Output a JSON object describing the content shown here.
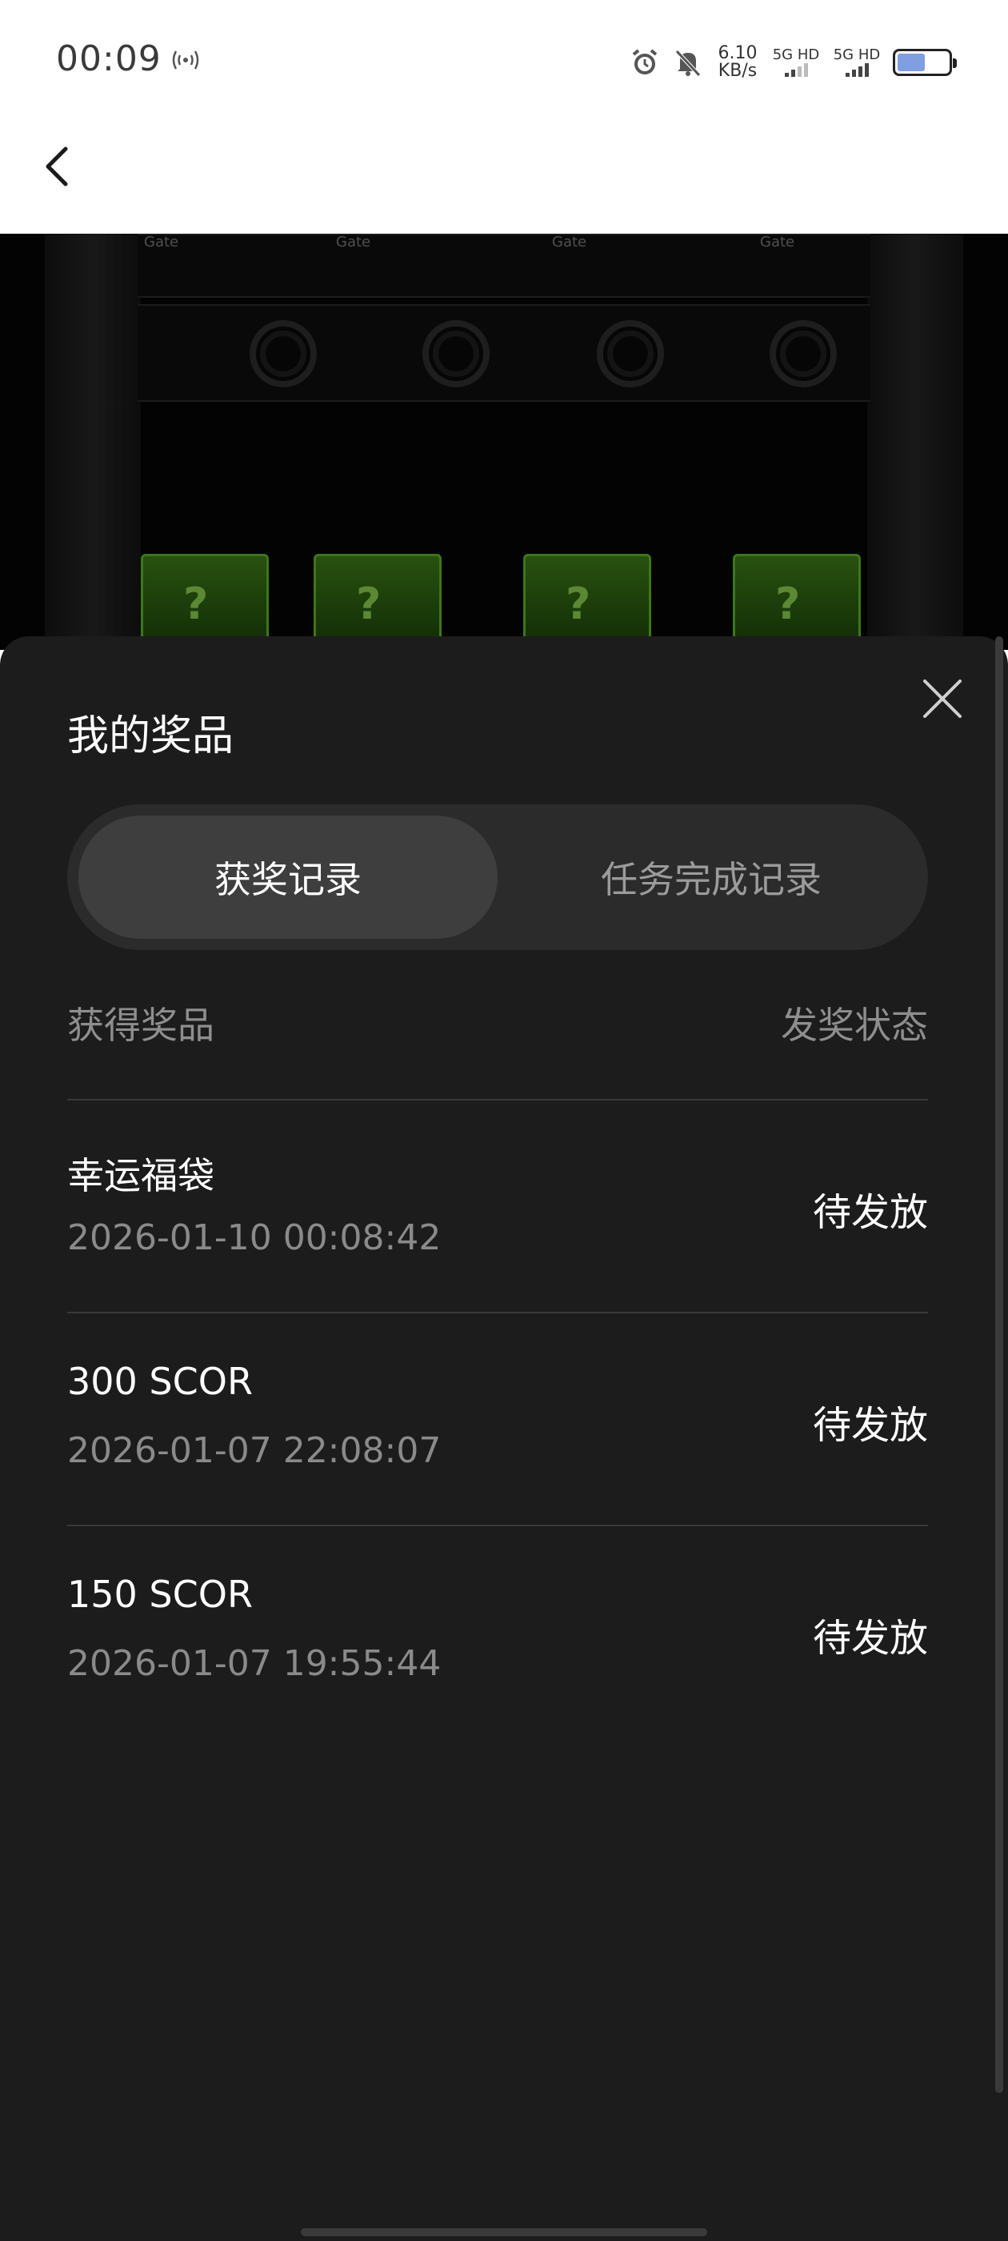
{
  "status_bar": {
    "time": "00:09",
    "hotspot_icon": "hotspot-icon",
    "speed_value": "6.10",
    "speed_unit": "KB/s",
    "sim1_label": "5G HD",
    "sim2_label": "5G HD",
    "alarm_icon": "alarm-icon",
    "mute_icon": "bell-off-icon",
    "battery_level": 0.55,
    "battery_color": "#7f9fe0"
  },
  "header": {
    "back_icon": "chevron-left-icon"
  },
  "scene": {
    "brand_labels": [
      "Gate",
      "Gate",
      "Gate",
      "Gate"
    ],
    "box_glyph": "?",
    "box_color": "#3e7d18"
  },
  "sheet": {
    "title": "我的奖品",
    "close_icon": "close-icon",
    "tabs": [
      {
        "label": "获奖记录",
        "active": true
      },
      {
        "label": "任务完成记录",
        "active": false
      }
    ],
    "columns": {
      "prize": "获得奖品",
      "status": "发奖状态"
    },
    "records": [
      {
        "name": "幸运福袋",
        "time": "2026-01-10 00:08:42",
        "status": "待发放"
      },
      {
        "name": "300 SCOR",
        "time": "2026-01-07 22:08:07",
        "status": "待发放"
      },
      {
        "name": "150 SCOR",
        "time": "2026-01-07 19:55:44",
        "status": "待发放"
      }
    ]
  }
}
